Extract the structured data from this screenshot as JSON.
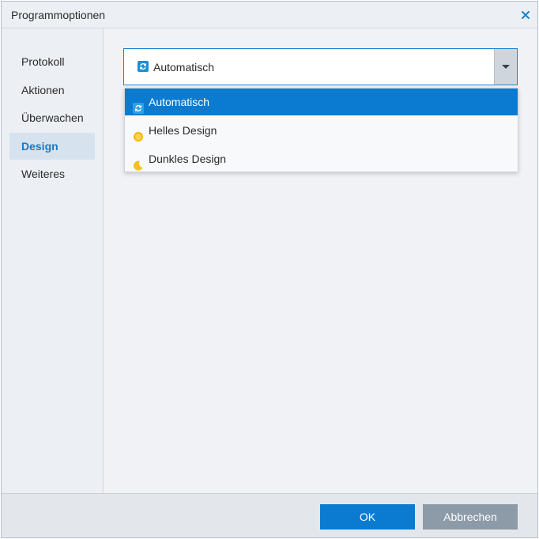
{
  "window": {
    "title": "Programmoptionen"
  },
  "sidebar": {
    "items": [
      {
        "label": "Protokoll",
        "active": false
      },
      {
        "label": "Aktionen",
        "active": false
      },
      {
        "label": "Überwachen",
        "active": false
      },
      {
        "label": "Design",
        "active": true
      },
      {
        "label": "Weiteres",
        "active": false
      }
    ]
  },
  "design_select": {
    "selected_label": "Automatisch",
    "selected_icon": "auto-theme-icon",
    "expanded": true,
    "options": [
      {
        "label": "Automatisch",
        "icon": "auto-theme-icon",
        "selected": true
      },
      {
        "label": "Helles Design",
        "icon": "sun-icon",
        "selected": false
      },
      {
        "label": "Dunkles Design",
        "icon": "moon-icon",
        "selected": false
      }
    ]
  },
  "footer": {
    "ok_label": "OK",
    "cancel_label": "Abbrechen"
  },
  "colors": {
    "accent": "#0a7bd0",
    "sidebar_active_bg": "#d6e2ee",
    "cancel_button": "#8d9aa8"
  }
}
